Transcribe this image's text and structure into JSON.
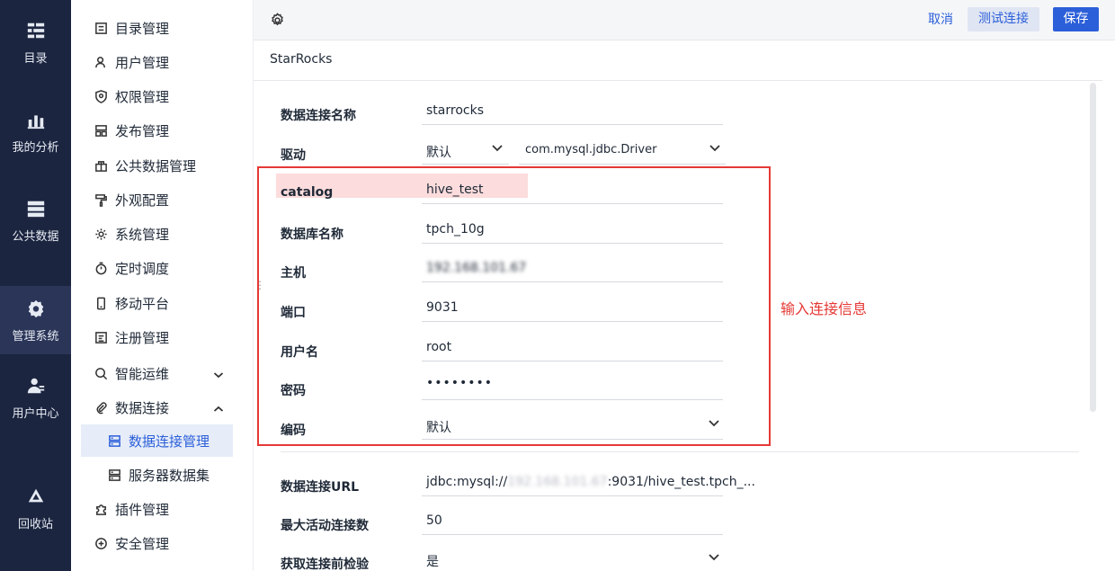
{
  "rail": {
    "items": [
      {
        "label": "目录"
      },
      {
        "label": "我的分析"
      },
      {
        "label": "公共数据"
      },
      {
        "label": "管理系统"
      },
      {
        "label": "用户中心"
      },
      {
        "label": "回收站"
      }
    ]
  },
  "sidebar": {
    "items": [
      {
        "label": "目录管理"
      },
      {
        "label": "用户管理"
      },
      {
        "label": "权限管理"
      },
      {
        "label": "发布管理"
      },
      {
        "label": "公共数据管理"
      },
      {
        "label": "外观配置"
      },
      {
        "label": "系统管理"
      },
      {
        "label": "定时调度"
      },
      {
        "label": "移动平台"
      },
      {
        "label": "注册管理"
      },
      {
        "label": "智能运维"
      },
      {
        "label": "数据连接"
      },
      {
        "label": "数据连接管理"
      },
      {
        "label": "服务器数据集"
      },
      {
        "label": "插件管理"
      },
      {
        "label": "安全管理"
      }
    ]
  },
  "toolbar": {
    "cancel_label": "取消",
    "test_label": "测试连接",
    "save_label": "保存"
  },
  "connection": {
    "title": "StarRocks",
    "fields": [
      {
        "label": "数据连接名称",
        "value": "starrocks"
      },
      {
        "label": "驱动",
        "value": "默认",
        "value2": "com.mysql.jdbc.Driver"
      },
      {
        "label": "catalog",
        "value": "hive_test"
      },
      {
        "label": "数据库名称",
        "value": "tpch_10g"
      },
      {
        "label": "主机",
        "value": "192.168.101.67"
      },
      {
        "label": "端口",
        "value": "9031"
      },
      {
        "label": "用户名",
        "value": "root"
      },
      {
        "label": "密码",
        "value": "••••••••"
      },
      {
        "label": "编码",
        "value": "默认"
      },
      {
        "label": "数据连接URL",
        "value_prefix": "jdbc:mysql://",
        "value_host": "192.168.101.67",
        "value_suffix": ":9031/hive_test.tpch_..."
      },
      {
        "label": "最大活动连接数",
        "value": "50"
      },
      {
        "label": "获取连接前检验",
        "value": "是"
      }
    ]
  },
  "annotation": "输入连接信息",
  "colors": {
    "rail_bg": "#1b2540",
    "accent": "#2b5fd9",
    "highlight_red": "#e53935"
  }
}
